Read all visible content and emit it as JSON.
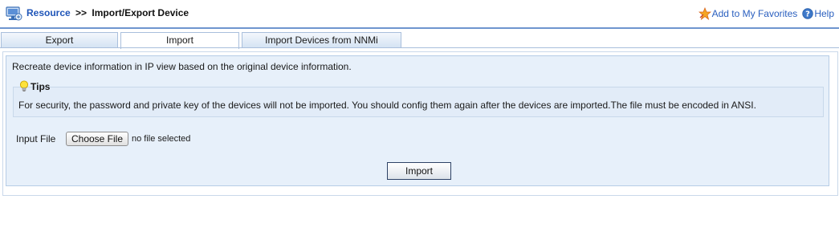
{
  "header": {
    "breadcrumb_link": "Resource",
    "breadcrumb_separator": ">>",
    "breadcrumb_current": "Import/Export Device",
    "favorites_label": "Add to My Favorites",
    "help_label": "Help",
    "icons": [
      "resource-icon",
      "favorite-star-icon",
      "help-icon"
    ]
  },
  "tabs": [
    {
      "label": "Export",
      "active": false
    },
    {
      "label": "Import",
      "active": true
    },
    {
      "label": "Import Devices from NNMi",
      "active": false
    }
  ],
  "main": {
    "description": "Recreate device information in IP view based on the original device information.",
    "tips_title": "Tips",
    "tips_icon": "lightbulb-icon",
    "tips_text": "For security, the password and private key of the devices will not be imported. You should config them again after the devices are imported.The file must be encoded in ANSI.",
    "input_file_label": "Input File",
    "choose_file_label": "Choose File",
    "no_file_text": "no file selected",
    "import_button_label": "Import"
  },
  "colors": {
    "link": "#1f55b8",
    "panel_bg": "#e7f0fa",
    "panel_border": "#b6cce6",
    "header_line": "#6e95cf"
  }
}
